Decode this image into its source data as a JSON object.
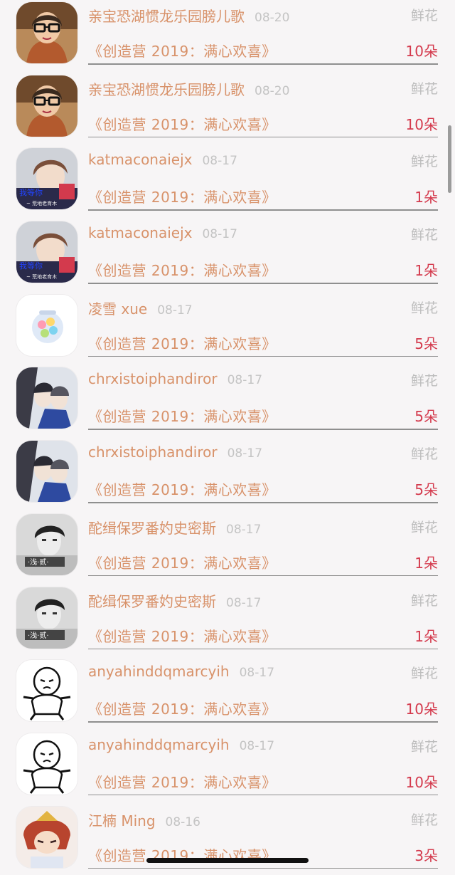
{
  "list": {
    "rows": [
      {
        "avatar": "woman-glasses-avatar",
        "name": "亲宝恐湖惯龙乐园膀儿歌",
        "date": "08-20",
        "gift_type": "鲜花",
        "work": "《创造营 2019：满心欢喜》",
        "count": "10朵"
      },
      {
        "avatar": "woman-glasses-avatar",
        "name": "亲宝恐湖惯龙乐园膀儿歌",
        "date": "08-20",
        "gift_type": "鲜花",
        "work": "《创造营 2019：满心欢喜》",
        "count": "10朵"
      },
      {
        "avatar": "boy-anime-avatar",
        "name": "katmaconaiejx",
        "date": "08-17",
        "gift_type": "鲜花",
        "work": "《创造营 2019：满心欢喜》",
        "count": "1朵"
      },
      {
        "avatar": "boy-anime-avatar",
        "name": "katmaconaiejx",
        "date": "08-17",
        "gift_type": "鲜花",
        "work": "《创造营 2019：满心欢喜》",
        "count": "1朵"
      },
      {
        "avatar": "candy-jar-avatar",
        "name": "凌雪 xue",
        "date": "08-17",
        "gift_type": "鲜花",
        "work": "《创造营 2019：满心欢喜》",
        "count": "5朵"
      },
      {
        "avatar": "anime-couple-avatar",
        "name": "chrxistoiphandiror",
        "date": "08-17",
        "gift_type": "鲜花",
        "work": "《创造营 2019：满心欢喜》",
        "count": "5朵"
      },
      {
        "avatar": "anime-couple-avatar",
        "name": "chrxistoiphandiror",
        "date": "08-17",
        "gift_type": "鲜花",
        "work": "《创造营 2019：满心欢喜》",
        "count": "5朵"
      },
      {
        "avatar": "bw-portrait-avatar",
        "name": "酡缉保罗番妁史密斯",
        "date": "08-17",
        "gift_type": "鲜花",
        "work": "《创造营 2019：满心欢喜》",
        "count": "1朵"
      },
      {
        "avatar": "bw-portrait-avatar",
        "name": "酡缉保罗番妁史密斯",
        "date": "08-17",
        "gift_type": "鲜花",
        "work": "《创造营 2019：满心欢喜》",
        "count": "1朵"
      },
      {
        "avatar": "cartoon-baby-avatar",
        "name": "anyahinddqmarcyih",
        "date": "08-17",
        "gift_type": "鲜花",
        "work": "《创造营 2019：满心欢喜》",
        "count": "10朵"
      },
      {
        "avatar": "cartoon-baby-avatar",
        "name": "anyahinddqmarcyih",
        "date": "08-17",
        "gift_type": "鲜花",
        "work": "《创造营 2019：满心欢喜》",
        "count": "10朵"
      },
      {
        "avatar": "game-character-avatar",
        "name": "江楠 Ming",
        "date": "08-16",
        "gift_type": "鲜花",
        "work": "《创造营 2019：满心欢喜》",
        "count": "3朵"
      }
    ]
  },
  "colors": {
    "name": "#d8926a",
    "date": "#c4c4c4",
    "gift_type": "#bdbdbd",
    "count": "#d43a4d",
    "background": "#f7f5f6"
  }
}
